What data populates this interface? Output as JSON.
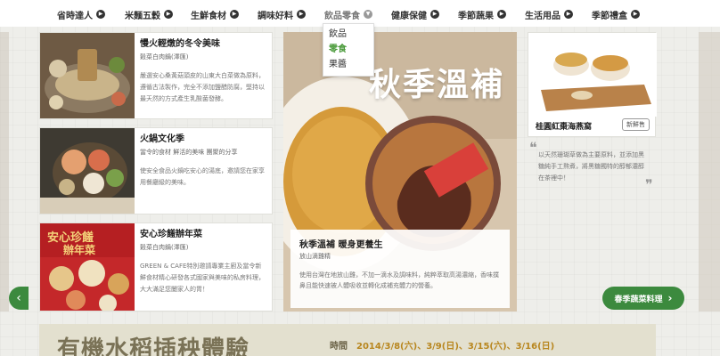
{
  "nav": {
    "items": [
      {
        "label": "省時達人"
      },
      {
        "label": "米麵五穀"
      },
      {
        "label": "生鮮食材"
      },
      {
        "label": "調味好料"
      },
      {
        "label": "飲品零食"
      },
      {
        "label": "健康保健"
      },
      {
        "label": "季節蔬果"
      },
      {
        "label": "生活用品"
      },
      {
        "label": "季節禮盒"
      }
    ],
    "dropdown": [
      "飲品",
      "零食",
      "果醬"
    ]
  },
  "cards": [
    {
      "title": "慢火輕燉的冬令美味",
      "sub": "穀菜白肉鍋(澤匯)",
      "desc": "嚴選安心桑黃菇頭皮的山東大白菜做為原料，遵循古法製作，完全不添加鹽醋防腐，堅持以最天然的方式產生乳酸菌發酵。"
    },
    {
      "title": "火鍋文化季",
      "sub": "當令的食材 鮮活的美味 團聚的分享",
      "desc": "使安全食品火鍋吃安心的湯底，邀請您在家享用餐廳級的美味。"
    },
    {
      "title": "安心珍饈辦年菜",
      "sub": "穀菜白肉鍋(澤匯)",
      "desc": "GREEN & CAFE特別邀請專業主廚及當令新鮮食材精心研發各式國家與美味的私房料理，大大滿足您闔家人的胃！"
    }
  ],
  "banner": {
    "title": "秋季溫補",
    "caption_title": "秋季溫補 暖身更養生",
    "caption_sub": "放山滴雞精",
    "caption_desc": "使用台灣在地放山雞，不加一滴水及調味料，純粹萃取高湯濃縮，香味撲鼻且能快速被人體吸收並轉化成補充體力的營養。"
  },
  "product": {
    "name": "桂圓紅棗海燕窩",
    "tag": "新鮮售",
    "quote": "以天然珊瑚草做為主要原料，並添加黑糖純手工熬煮，將黑糖獨特的醇郁濃醇在茶裡中！"
  },
  "season_button": "春季蔬菜料理",
  "event": {
    "title": "有機水稻插秧體驗",
    "time_label": "時間",
    "dates": "2014/3/8(六)、3/9(日)、3/15(六)、3/16(日)"
  },
  "colors": {
    "brand_green": "#3c8a3e",
    "date_gold": "#b8861e"
  }
}
